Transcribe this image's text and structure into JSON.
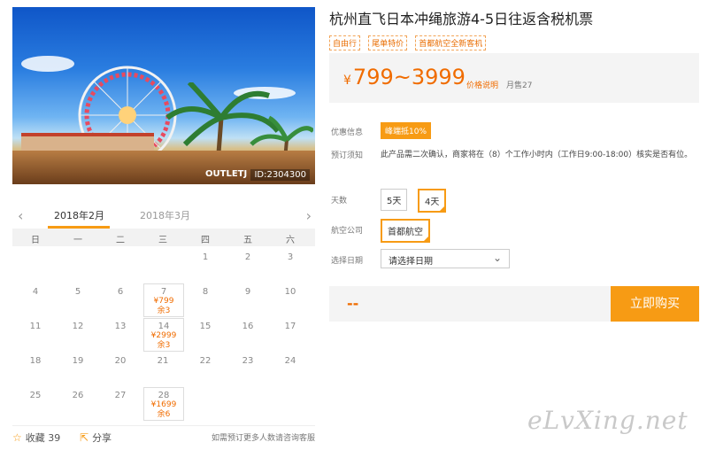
{
  "hero": {
    "image_id": "ID:2304300",
    "sign_text": "OUTLETJ"
  },
  "calendar": {
    "tabs": [
      {
        "label": "2018年2月"
      },
      {
        "label": "2018年3月"
      }
    ],
    "weekdays": [
      "日",
      "一",
      "二",
      "三",
      "四",
      "五",
      "六"
    ],
    "days": [
      {
        "d": "1"
      },
      {
        "d": "2"
      },
      {
        "d": "3"
      },
      {
        "d": "4"
      },
      {
        "d": "5"
      },
      {
        "d": "6"
      },
      {
        "d": "7",
        "price": "¥799",
        "left": "余3"
      },
      {
        "d": "8"
      },
      {
        "d": "9"
      },
      {
        "d": "10"
      },
      {
        "d": "11"
      },
      {
        "d": "12"
      },
      {
        "d": "13"
      },
      {
        "d": "14",
        "price": "¥2999",
        "left": "余3"
      },
      {
        "d": "15"
      },
      {
        "d": "16"
      },
      {
        "d": "17"
      },
      {
        "d": "18"
      },
      {
        "d": "19"
      },
      {
        "d": "20"
      },
      {
        "d": "21"
      },
      {
        "d": "22"
      },
      {
        "d": "23"
      },
      {
        "d": "24"
      },
      {
        "d": "25"
      },
      {
        "d": "26"
      },
      {
        "d": "27"
      },
      {
        "d": "28",
        "price": "¥1699",
        "left": "余6"
      }
    ],
    "footer": {
      "favorite": "收藏 39",
      "share": "分享",
      "note": "如需预订更多人数请咨询客服"
    }
  },
  "product": {
    "title": "杭州直飞日本冲绳旅游4-5日往返含税机票",
    "tags": [
      "自由行",
      "尾单特价",
      "首都航空全新客机"
    ],
    "price": {
      "currency": "¥",
      "range": "799~3999",
      "explain": "价格说明",
      "sold": "月售27"
    }
  },
  "info": {
    "promo_label": "优惠信息",
    "promo": "峰端抵10%",
    "notice_label": "预订须知",
    "notice": "此产品需二次确认，商家将在（8）个工作小时内（工作日9:00-18:00）核实是否有位。"
  },
  "options": {
    "days_label": "天数",
    "days": [
      "5天",
      "4天"
    ],
    "days_selected": "4天",
    "airline_label": "航空公司",
    "airline": "首都航空",
    "date_label": "选择日期",
    "date_placeholder": "请选择日期"
  },
  "buy": {
    "total": "--",
    "button": "立即购买"
  },
  "watermark": "eLvXing.net"
}
